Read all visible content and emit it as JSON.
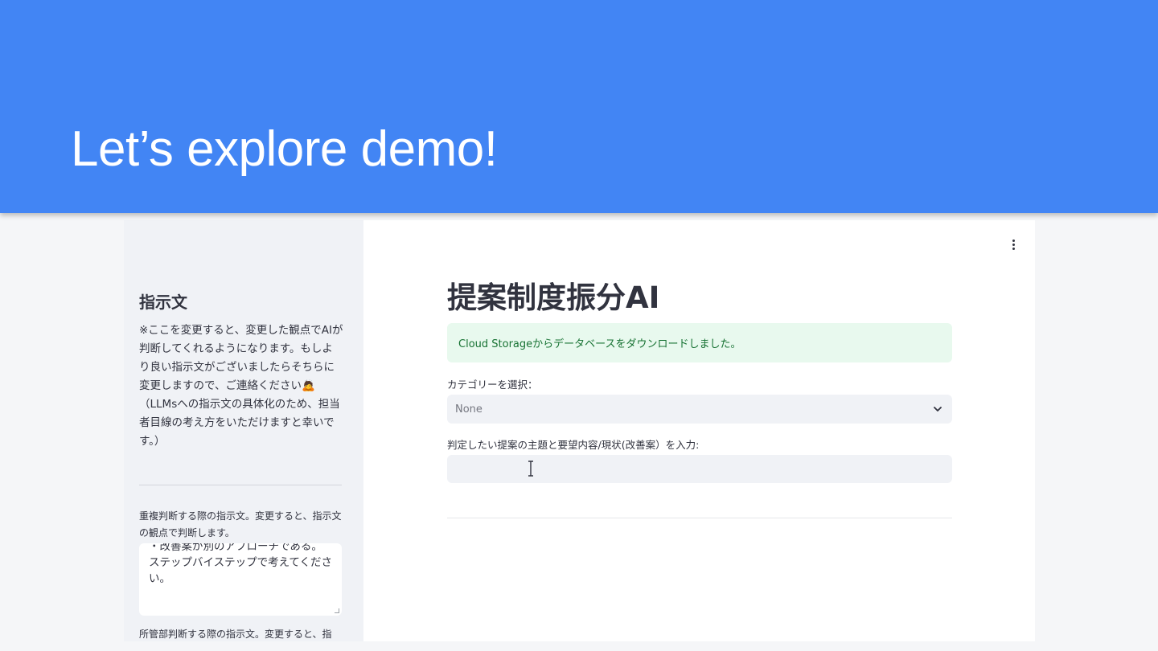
{
  "banner": {
    "title": "Let’s explore demo!"
  },
  "sidebar": {
    "heading": "指示文",
    "description": "※ここを変更すると、変更した観点でAIが判断してくれるようになります。もしより良い指示文がございましたらそちらに変更しますので、ご連絡ください🙇（LLMsへの指示文の具体化のため、担当者目線の考え方をいただけますと幸いです。）",
    "duplicate_label": "重複判断する際の指示文。変更すると、指示文の観点で判断します。",
    "duplicate_textarea_value": "・改善案が別のアプローチである。\nステップバイステップで考えてください。",
    "department_label": "所管部判断する際の指示文。変更すると、指"
  },
  "main": {
    "title": "提案制度振分AI",
    "success_message": "Cloud Storageからデータベースをダウンロードしました。",
    "category_label": "カテゴリーを選択：",
    "category_value": "None",
    "proposal_label": "判定したい提案の主題と要望内容/現状(改善案）を入力:",
    "proposal_value": ""
  },
  "colors": {
    "banner": "#4285f4",
    "sidebar": "#f0f2f6",
    "success_bg": "#e8f9ee",
    "success_text": "#177233"
  }
}
